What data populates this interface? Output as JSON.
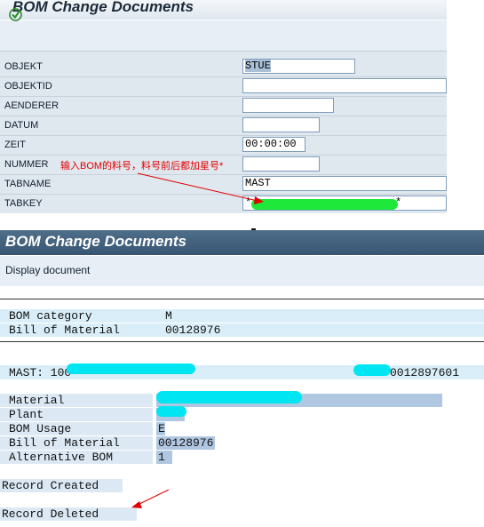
{
  "top": {
    "title": "BOM Change Documents",
    "form": [
      {
        "label": "OBJEKT",
        "value": "STUE"
      },
      {
        "label": "OBJEKTID",
        "value": ""
      },
      {
        "label": "AENDERER",
        "value": ""
      },
      {
        "label": "DATUM",
        "value": ""
      },
      {
        "label": "ZEIT",
        "value": "00:00:00"
      },
      {
        "label": "NUMMER",
        "value": ""
      },
      {
        "label": "TABNAME",
        "value": "MAST"
      },
      {
        "label": "TABKEY",
        "value": "*",
        "value_end": "*"
      }
    ],
    "annotation": "输入BOM的料号，料号前后都加星号*"
  },
  "bottom": {
    "title": "BOM Change Documents",
    "subtitle": "Display document",
    "header_fields": [
      {
        "label": "BOM category",
        "value": "M"
      },
      {
        "label": "Bill of Material",
        "value": "00128976"
      }
    ],
    "mast_label": "MAST: 100",
    "mast_key": "0012897601",
    "detail_fields": [
      {
        "label": "Material",
        "value": ""
      },
      {
        "label": "Plant",
        "value": ""
      },
      {
        "label": "BOM Usage",
        "value": "E"
      },
      {
        "label": "Bill of Material",
        "value": "00128976"
      },
      {
        "label": "Alternative BOM",
        "value": "1"
      }
    ],
    "record_created": "Record Created",
    "record_deleted": "Record Deleted"
  }
}
